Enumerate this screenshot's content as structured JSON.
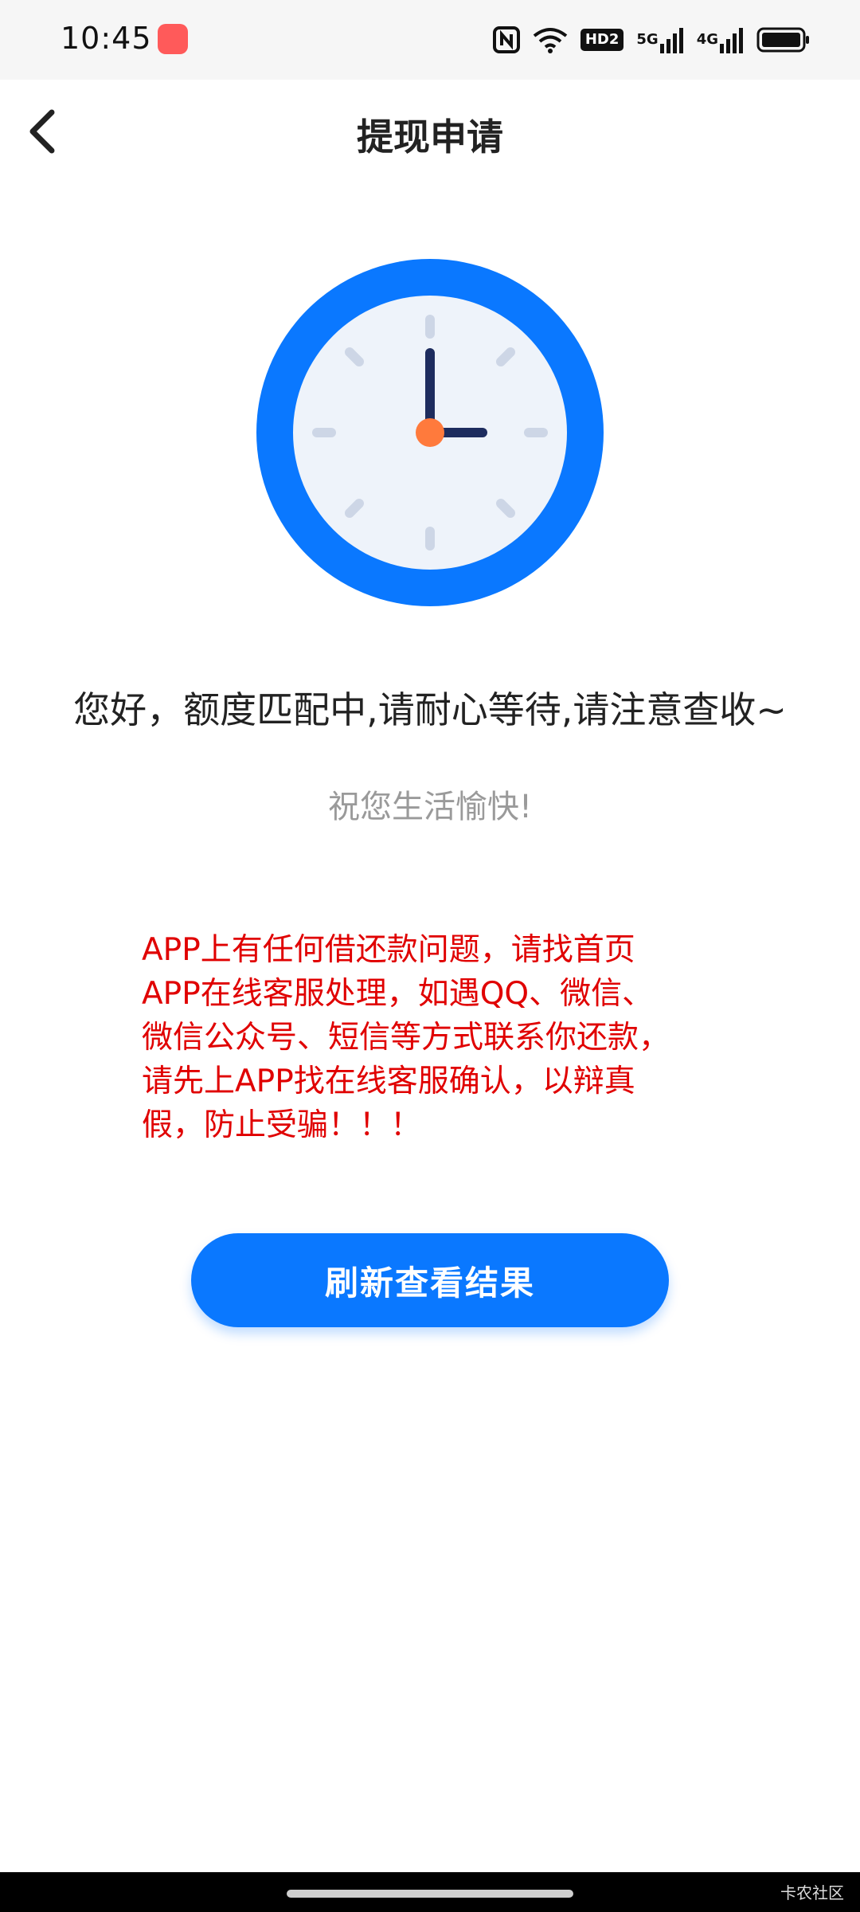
{
  "status_bar": {
    "time": "10:45",
    "network_5g": "5G",
    "network_4g": "4G",
    "hd": "HD2"
  },
  "header": {
    "title": "提现申请"
  },
  "main": {
    "message": "您好，额度匹配中,请耐心等待,请注意查收~",
    "subtext": "祝您生活愉快!",
    "warning_lines": [
      "APP上有任何借还款问题，请找首页",
      "APP在线客服处理，如遇QQ、微信、",
      "微信公众号、短信等方式联系你还款，",
      "请先上APP找在线客服确认，以辩真",
      "假，防止受骗！！！"
    ],
    "refresh_button_label": "刷新查看结果"
  },
  "footer": {
    "watermark": "卡农社区"
  },
  "colors": {
    "accent": "#0a78ff",
    "warning": "#e00000",
    "clock_face": "#eef3fa",
    "clock_center": "#ff7a3c"
  },
  "icons": {
    "back": "chevron-left-icon",
    "clock": "clock-icon"
  }
}
